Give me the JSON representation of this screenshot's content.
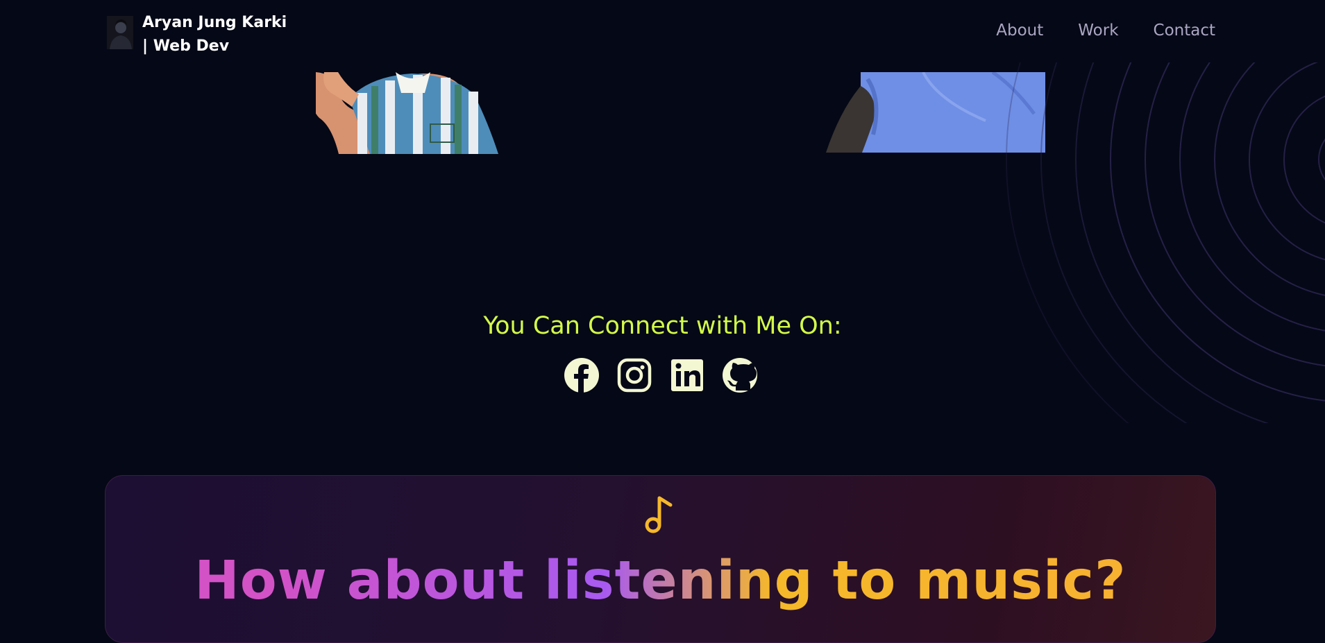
{
  "header": {
    "brand": "Aryan Jung Karki | Web Dev",
    "nav": [
      {
        "label": "About"
      },
      {
        "label": "Work"
      },
      {
        "label": "Contact"
      }
    ]
  },
  "connect": {
    "title": "You Can Connect with Me On:",
    "icons": [
      "facebook-icon",
      "instagram-icon",
      "linkedin-icon",
      "github-icon"
    ]
  },
  "music": {
    "title": "How about listening to music?",
    "icon": "music-note-icon"
  },
  "colors": {
    "background": "#050816",
    "accent_green": "#d4fc49",
    "icon_fill": "#f3f7d2",
    "note_yellow": "#f5b82a",
    "nav_text": "#aaa6c3"
  }
}
